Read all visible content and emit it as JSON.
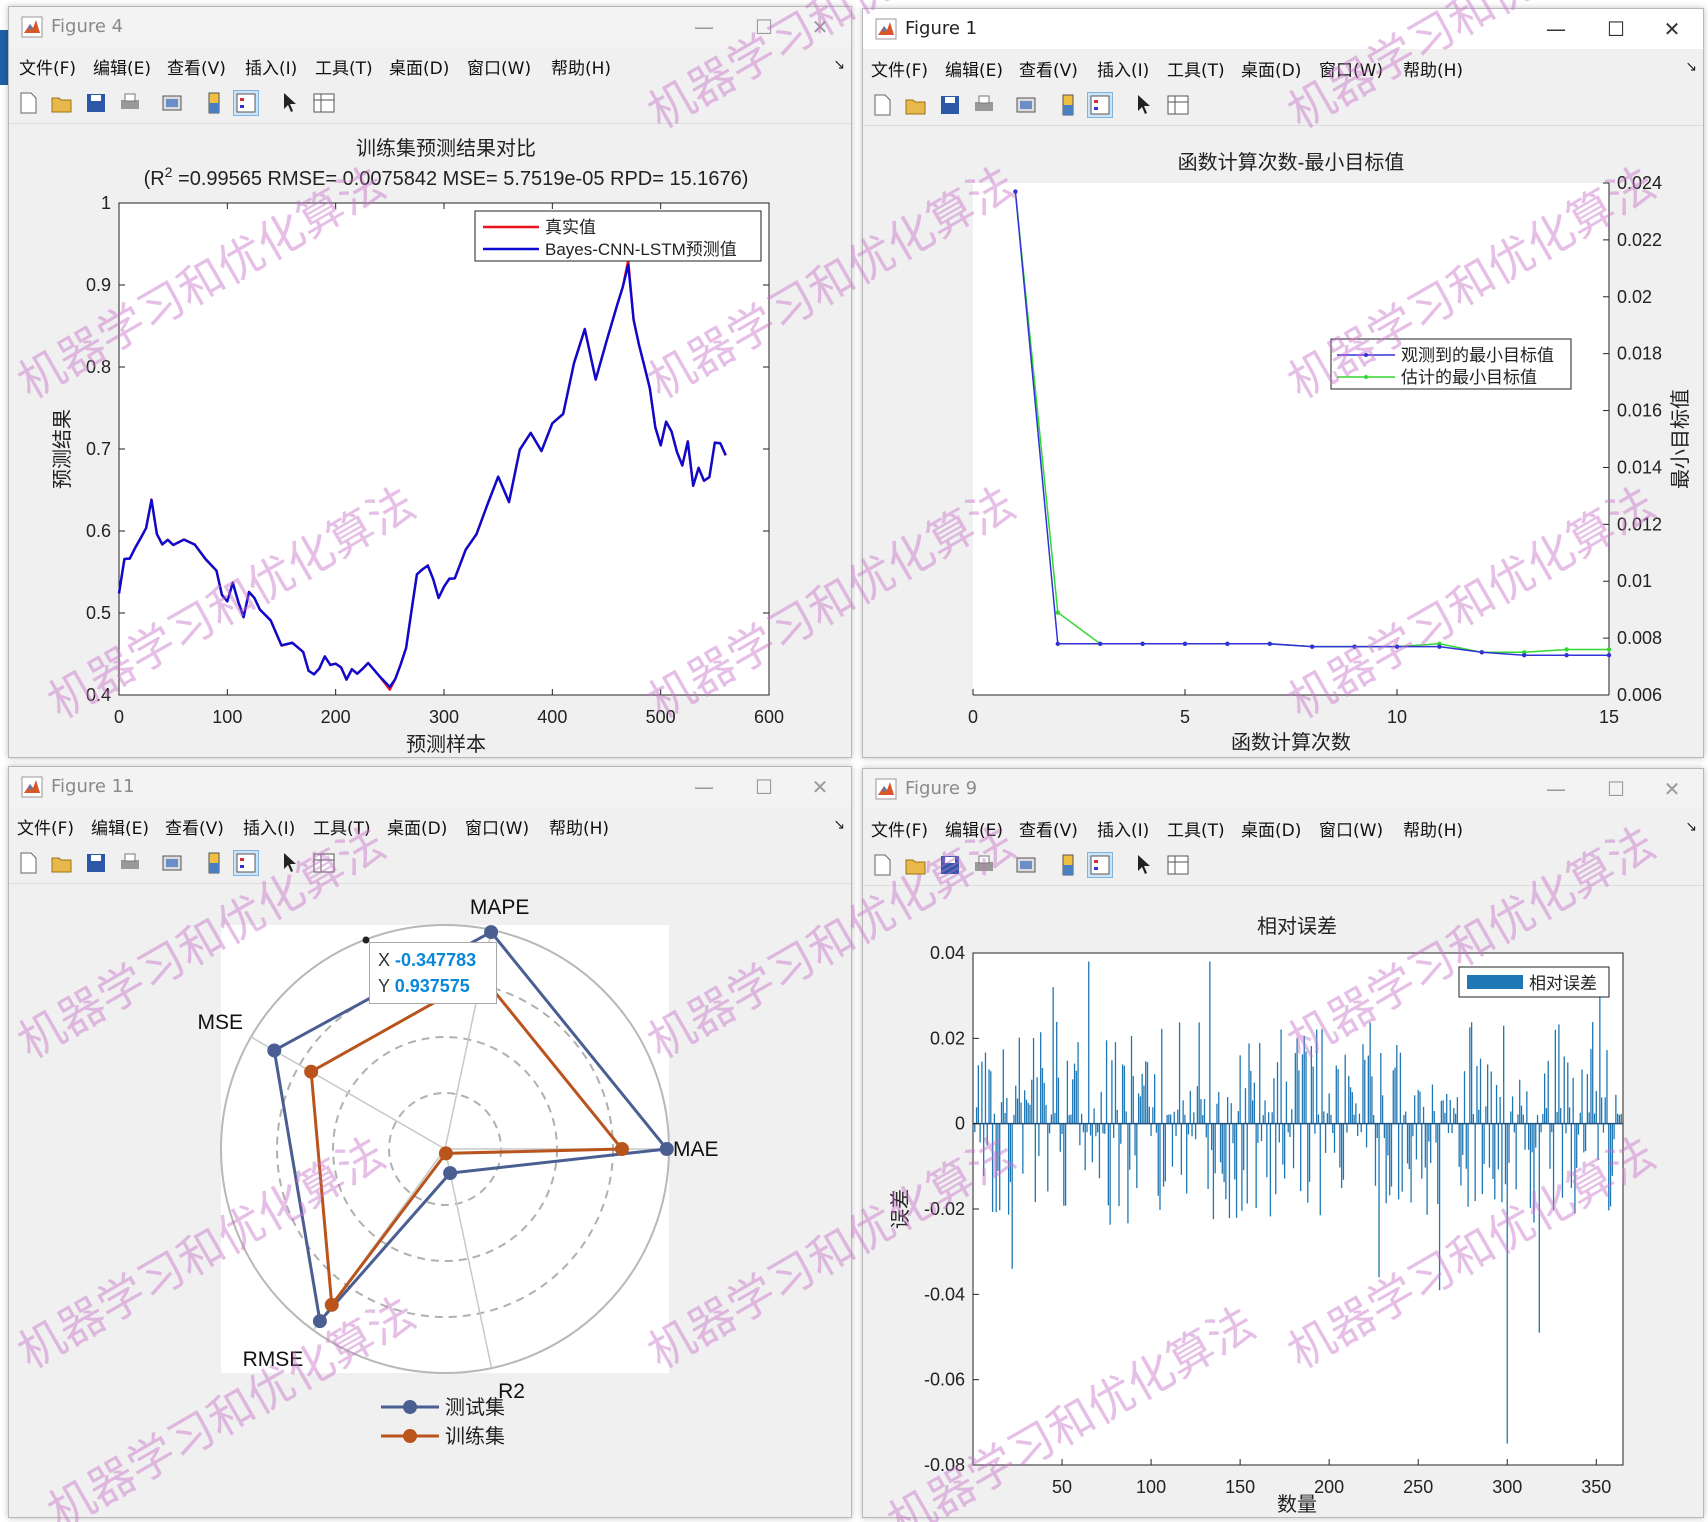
{
  "menu": [
    "文件(F)",
    "编辑(E)",
    "查看(V)",
    "插入(I)",
    "工具(T)",
    "桌面(D)",
    "窗口(W)",
    "帮助(H)"
  ],
  "watermark": "机器学习和优化算法",
  "figures": {
    "fig4": {
      "title": "Figure 4",
      "plot_title": "训练集预测结果对比",
      "plot_subtitle_prefix": "(R",
      "plot_subtitle_sup": "2",
      "plot_subtitle_rest": " =0.99565 RMSE= 0.0075842 MSE= 5.7519e-05 RPD= 15.1676)",
      "xlabel": "预测样本",
      "ylabel": "预测结果",
      "legend": [
        "真实值",
        "Bayes-CNN-LSTM预测值"
      ]
    },
    "fig1": {
      "title": "Figure 1",
      "plot_title": "函数计算次数-最小目标值",
      "xlabel": "函数计算次数",
      "ylabel": "最小目标值",
      "legend": [
        "观测到的最小目标值",
        "估计的最小目标值"
      ]
    },
    "fig11": {
      "title": "Figure 11",
      "axes_labels": [
        "MAPE",
        "MAE",
        "R2",
        "RMSE",
        "MSE"
      ],
      "legend": [
        "测试集",
        "训练集"
      ],
      "datatip": {
        "x_label": "X",
        "x_value": "-0.347783",
        "y_label": "Y",
        "y_value": "0.937575"
      }
    },
    "fig9": {
      "title": "Figure 9",
      "plot_title": "相对误差",
      "xlabel": "数量",
      "ylabel": "误差",
      "legend": [
        "相对误差"
      ]
    }
  },
  "colors": {
    "real": "#e8141e",
    "pred": "#0a0ad0",
    "observed": "#3232d8",
    "estimated": "#32d832",
    "test": "#4a5e92",
    "train": "#b9541d",
    "bar": "#1f77b4",
    "watermark": "#c870c8"
  },
  "chart_data": [
    {
      "id": "fig4",
      "type": "line",
      "title": "训练集预测结果对比",
      "xlabel": "预测样本",
      "ylabel": "预测结果",
      "xlim": [
        0,
        600
      ],
      "ylim": [
        0.4,
        1
      ],
      "xticks": [
        0,
        100,
        200,
        300,
        400,
        500,
        600
      ],
      "yticks": [
        0.4,
        0.5,
        0.6,
        0.7,
        0.8,
        0.9,
        1
      ],
      "x": [
        0,
        5,
        10,
        15,
        20,
        25,
        30,
        35,
        40,
        45,
        50,
        60,
        70,
        80,
        90,
        95,
        100,
        105,
        110,
        115,
        120,
        125,
        130,
        140,
        150,
        160,
        170,
        175,
        180,
        185,
        190,
        195,
        200,
        205,
        210,
        215,
        220,
        225,
        230,
        240,
        250,
        255,
        260,
        265,
        270,
        275,
        280,
        285,
        290,
        295,
        300,
        305,
        310,
        320,
        330,
        340,
        350,
        360,
        370,
        380,
        390,
        400,
        410,
        420,
        430,
        440,
        450,
        460,
        465,
        470,
        475,
        480,
        485,
        490,
        495,
        500,
        505,
        510,
        515,
        520,
        525,
        530,
        535,
        540,
        545,
        550,
        555,
        560
      ],
      "series": [
        {
          "name": "真实值",
          "values": [
            0.52,
            0.56,
            0.575,
            0.58,
            0.59,
            0.605,
            0.63,
            0.6,
            0.59,
            0.585,
            0.585,
            0.585,
            0.58,
            0.575,
            0.55,
            0.52,
            0.515,
            0.53,
            0.52,
            0.5,
            0.52,
            0.52,
            0.5,
            0.49,
            0.47,
            0.46,
            0.45,
            0.43,
            0.42,
            0.44,
            0.45,
            0.43,
            0.44,
            0.43,
            0.42,
            0.44,
            0.42,
            0.43,
            0.44,
            0.42,
            0.415,
            0.42,
            0.43,
            0.46,
            0.5,
            0.55,
            0.56,
            0.55,
            0.54,
            0.52,
            0.53,
            0.55,
            0.54,
            0.57,
            0.6,
            0.63,
            0.67,
            0.64,
            0.69,
            0.72,
            0.7,
            0.73,
            0.75,
            0.8,
            0.84,
            0.79,
            0.83,
            0.88,
            0.9,
            0.92,
            0.86,
            0.83,
            0.8,
            0.78,
            0.72,
            0.7,
            0.74,
            0.72,
            0.7,
            0.68,
            0.7,
            0.66,
            0.68,
            0.66,
            0.67,
            0.7,
            0.705,
            0.7
          ]
        },
        {
          "name": "Bayes-CNN-LSTM预测值",
          "values": [
            0.52,
            0.56,
            0.575,
            0.58,
            0.59,
            0.605,
            0.63,
            0.6,
            0.59,
            0.585,
            0.585,
            0.585,
            0.58,
            0.575,
            0.55,
            0.52,
            0.515,
            0.53,
            0.52,
            0.5,
            0.52,
            0.52,
            0.5,
            0.49,
            0.47,
            0.46,
            0.45,
            0.43,
            0.42,
            0.44,
            0.45,
            0.43,
            0.44,
            0.43,
            0.42,
            0.44,
            0.42,
            0.43,
            0.44,
            0.42,
            0.418,
            0.42,
            0.43,
            0.46,
            0.5,
            0.55,
            0.56,
            0.55,
            0.54,
            0.52,
            0.53,
            0.55,
            0.54,
            0.57,
            0.6,
            0.63,
            0.67,
            0.64,
            0.69,
            0.72,
            0.7,
            0.73,
            0.75,
            0.8,
            0.84,
            0.79,
            0.83,
            0.88,
            0.9,
            0.915,
            0.86,
            0.83,
            0.8,
            0.78,
            0.72,
            0.7,
            0.74,
            0.72,
            0.7,
            0.68,
            0.7,
            0.66,
            0.68,
            0.66,
            0.67,
            0.7,
            0.705,
            0.7
          ]
        }
      ],
      "legend_position": "top-right"
    },
    {
      "id": "fig1",
      "type": "line",
      "title": "函数计算次数-最小目标值",
      "xlabel": "函数计算次数",
      "ylabel": "最小目标值",
      "xlim": [
        0,
        15
      ],
      "ylim": [
        0.006,
        0.024
      ],
      "xticks": [
        0,
        5,
        10,
        15
      ],
      "yticks": [
        0.006,
        0.008,
        0.01,
        0.012,
        0.014,
        0.016,
        0.018,
        0.02,
        0.022,
        0.024
      ],
      "x": [
        1,
        2,
        3,
        4,
        5,
        6,
        7,
        8,
        9,
        10,
        11,
        12,
        13,
        14,
        15
      ],
      "series": [
        {
          "name": "观测到的最小目标值",
          "values": [
            0.0237,
            0.0078,
            0.0078,
            0.0078,
            0.0078,
            0.0078,
            0.0078,
            0.0077,
            0.0077,
            0.0077,
            0.0077,
            0.0075,
            0.0074,
            0.0074,
            0.0074
          ]
        },
        {
          "name": "估计的最小目标值",
          "values": [
            0.0237,
            0.0089,
            0.0078,
            0.0078,
            0.0078,
            0.0078,
            0.0078,
            0.0077,
            0.0077,
            0.0077,
            0.0078,
            0.0075,
            0.0075,
            0.0076,
            0.0076
          ]
        }
      ],
      "legend_position": "top-right"
    },
    {
      "id": "fig11",
      "type": "radar",
      "categories": [
        "MAPE",
        "MAE",
        "R2",
        "RMSE",
        "MSE"
      ],
      "series": [
        {
          "name": "测试集",
          "values": [
            0.99,
            0.99,
            0.11,
            0.95,
            0.88
          ]
        },
        {
          "name": "训练集",
          "values": [
            0.79,
            0.79,
            0.02,
            0.86,
            0.69
          ]
        }
      ],
      "legend_position": "bottom"
    },
    {
      "id": "fig9",
      "type": "bar",
      "title": "相对误差",
      "xlabel": "数量",
      "ylabel": "误差",
      "xlim": [
        0,
        365
      ],
      "ylim": [
        -0.08,
        0.04
      ],
      "xticks": [
        50,
        100,
        150,
        200,
        250,
        300,
        350
      ],
      "yticks": [
        -0.08,
        -0.06,
        -0.04,
        -0.02,
        0,
        0.02,
        0.04
      ],
      "highlights": [
        {
          "x": 22,
          "y": -0.034
        },
        {
          "x": 45,
          "y": 0.032
        },
        {
          "x": 65,
          "y": 0.038
        },
        {
          "x": 133,
          "y": 0.038
        },
        {
          "x": 228,
          "y": -0.036
        },
        {
          "x": 262,
          "y": -0.039
        },
        {
          "x": 300,
          "y": -0.075
        },
        {
          "x": 318,
          "y": -0.049
        },
        {
          "x": 352,
          "y": 0.031
        }
      ],
      "legend_position": "top-right"
    }
  ]
}
